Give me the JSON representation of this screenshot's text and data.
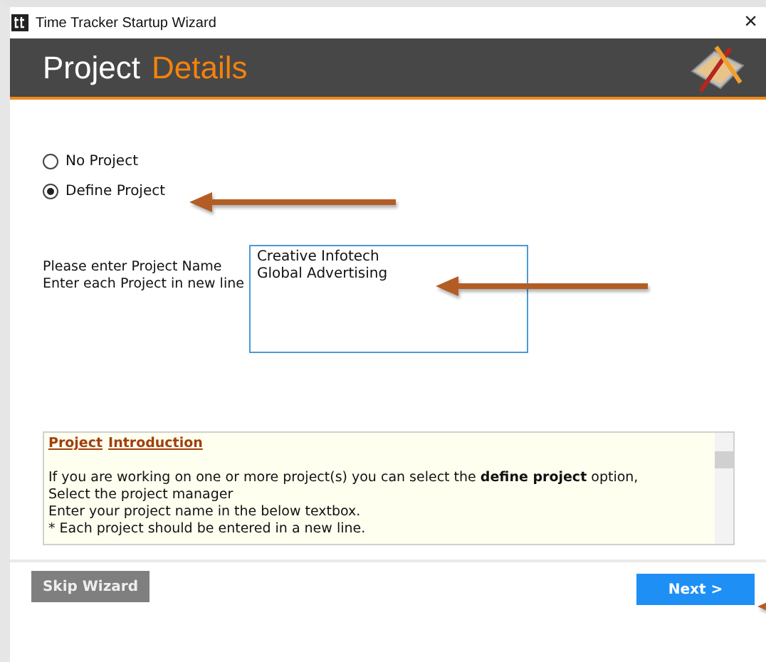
{
  "window": {
    "title": "Time Tracker Startup Wizard",
    "close": "×"
  },
  "header": {
    "title": "Project",
    "title_accent": "Details"
  },
  "options": [
    {
      "label": "No Project",
      "selected": false
    },
    {
      "label": "Define Project",
      "selected": true
    }
  ],
  "project_field": {
    "label_lines": [
      "Please enter Project Name",
      "Enter each Project in new line"
    ],
    "value": "Creative Infotech\nGlobal Advertising"
  },
  "introduction": {
    "heading": [
      "Project",
      "Introduction"
    ],
    "lines": [
      "If you are working on one or more project(s) you can select the **define project** option,",
      "Select the project manager",
      "Enter your project name in the below textbox.",
      "* Each project should be entered in a new line."
    ]
  },
  "buttons": {
    "skip": "Skip Wizard",
    "next": "Next >"
  }
}
